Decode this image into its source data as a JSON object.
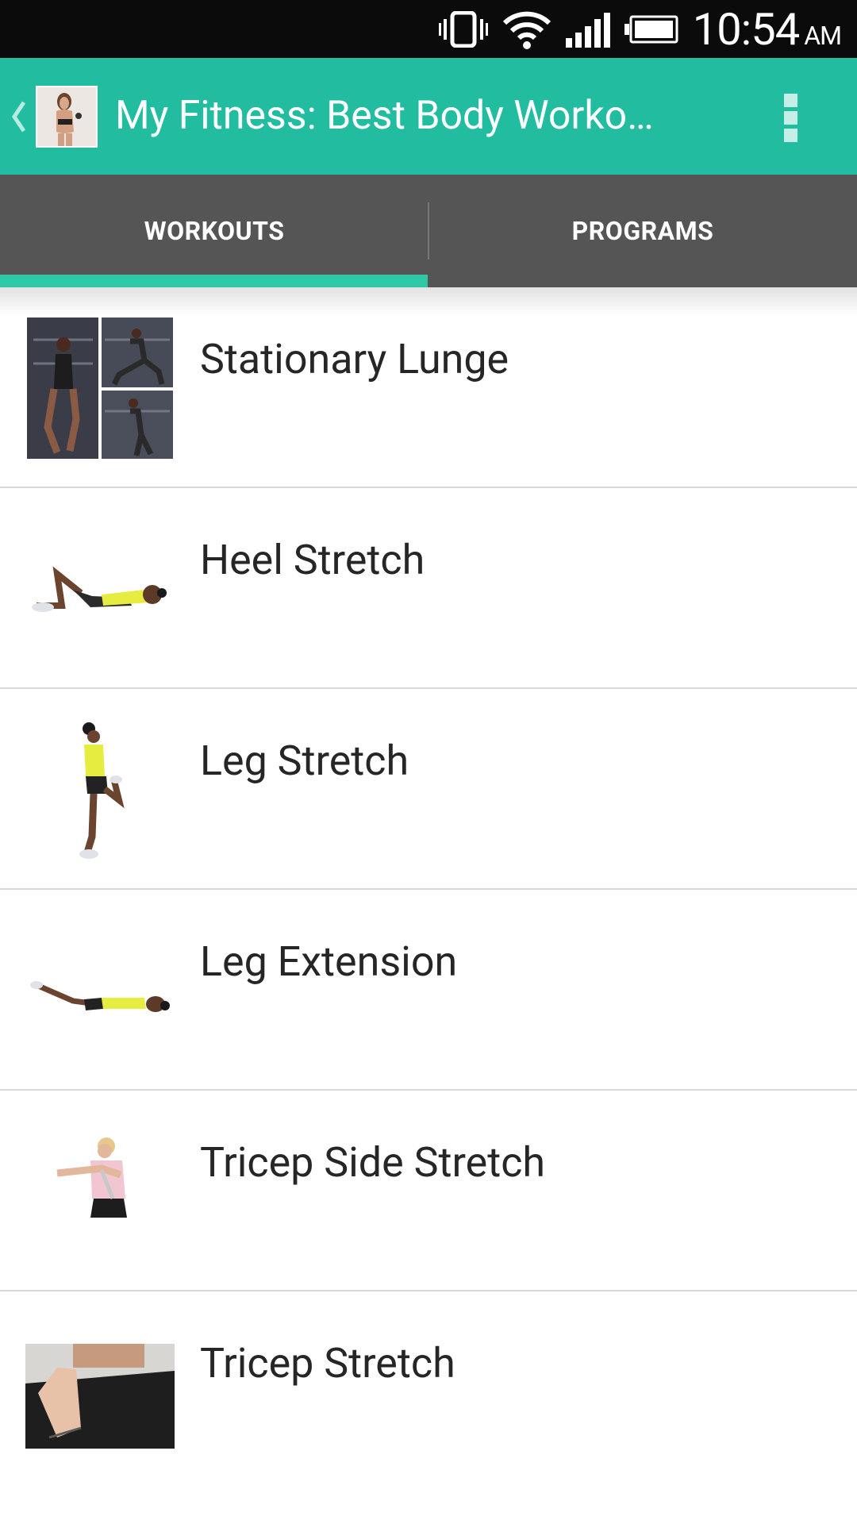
{
  "status_bar": {
    "time": "10:54",
    "ampm": "AM",
    "icons": [
      "vibrate-icon",
      "wifi-icon",
      "signal-icon",
      "battery-icon"
    ]
  },
  "action_bar": {
    "title": "My Fitness: Best Body Worko…",
    "color": "#22bda0"
  },
  "tabs": [
    {
      "label": "WORKOUTS",
      "selected": true
    },
    {
      "label": "PROGRAMS",
      "selected": false
    }
  ],
  "workouts": [
    {
      "name": "Stationary Lunge",
      "thumbnail": "lunge-collage-thumbnail"
    },
    {
      "name": "Heel Stretch",
      "thumbnail": "heel-stretch-thumbnail"
    },
    {
      "name": "Leg Stretch",
      "thumbnail": "leg-stretch-thumbnail"
    },
    {
      "name": "Leg Extension",
      "thumbnail": "leg-extension-thumbnail"
    },
    {
      "name": "Tricep Side Stretch",
      "thumbnail": "tricep-side-stretch-thumbnail"
    },
    {
      "name": "Tricep Stretch",
      "thumbnail": "tricep-stretch-thumbnail"
    }
  ],
  "colors": {
    "accent": "#22bda0",
    "tab_bar": "#555555",
    "indicator": "#2ec8a6"
  }
}
